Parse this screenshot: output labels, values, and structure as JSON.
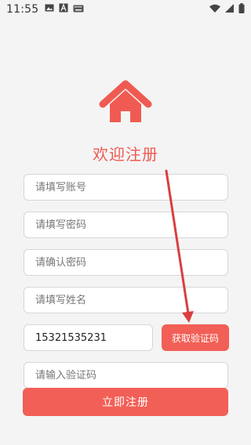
{
  "status_bar": {
    "time": "11:55",
    "icons": [
      "image-icon",
      "text-a-icon",
      "keyboard-icon",
      "wifi-icon",
      "signal-icon",
      "battery-icon"
    ]
  },
  "logo": {
    "icon": "home-icon",
    "color": "#ef5b52"
  },
  "title": "欢迎注册",
  "form": {
    "account_placeholder": "请填写账号",
    "password_placeholder": "请填写密码",
    "confirm_placeholder": "请确认密码",
    "name_placeholder": "请填写姓名",
    "phone_value": "15321535231",
    "code_button": "获取验证码",
    "code_placeholder": "请输入验证码",
    "submit_button": "立即注册"
  },
  "colors": {
    "accent": "#f25f56",
    "annotation_arrow": "#d93f3f"
  }
}
